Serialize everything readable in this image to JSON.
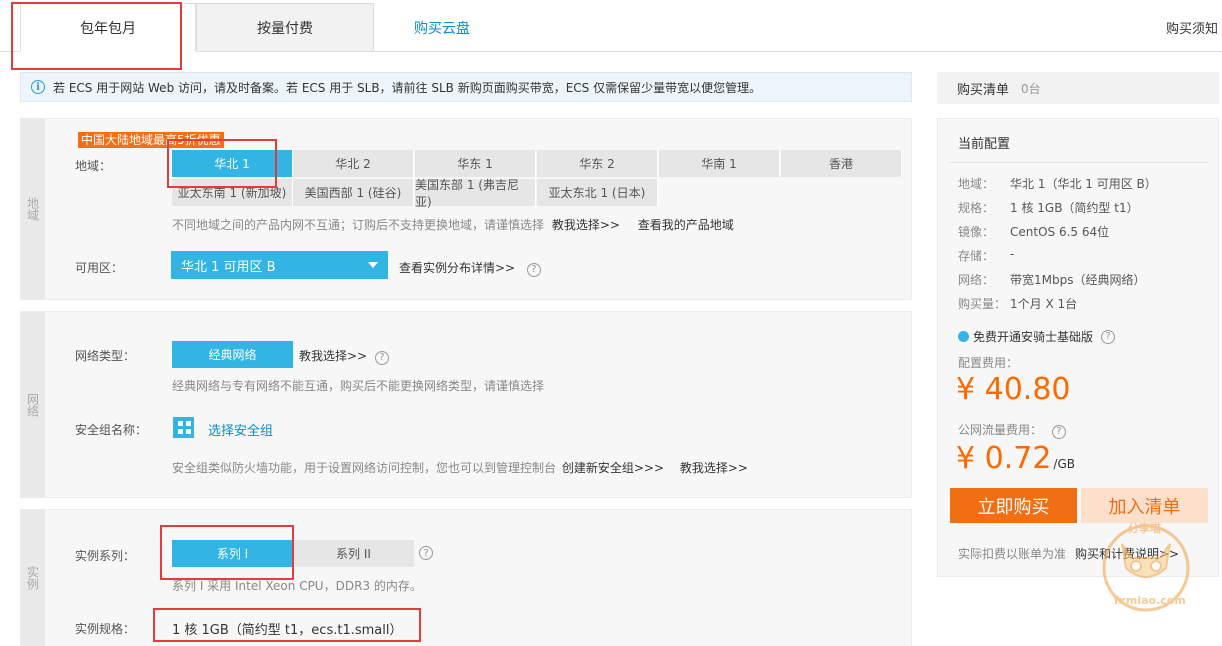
{
  "tabs": {
    "monthly": "包年包月",
    "payg": "按量付费",
    "cloud_disk": "购买云盘",
    "buy_notice": "购买须知"
  },
  "notice": "若 ECS 用于网站 Web 访问，请及时备案。若 ECS 用于 SLB，请前往 SLB 新购页面购买带宽，ECS 仅需保留少量带宽以便您管理。",
  "region_section": {
    "side_label": "地域",
    "promo": "中国大陆地域最高5折优惠",
    "region_label": "地域：",
    "regions_row1": [
      "华北 1",
      "华北 2",
      "华东 1",
      "华东 2",
      "华南 1",
      "香港"
    ],
    "regions_row2": [
      "亚太东南 1 (新加坡)",
      "美国西部 1 (硅谷)",
      "美国东部 1 (弗吉尼亚)",
      "亚太东北 1 (日本)"
    ],
    "hint": "不同地域之间的产品内网不互通；订购后不支持更换地域，请谨慎选择",
    "guide_link": "教我选择>>",
    "my_regions_link": "查看我的产品地域",
    "zone_label": "可用区：",
    "zone_value": "华北 1 可用区 B",
    "zone_details_link": "查看实例分布详情>>",
    "help": "?"
  },
  "network_section": {
    "side_label": "网络",
    "type_label": "网络类型：",
    "type_value": "经典网络",
    "guide_link": "教我选择>>",
    "type_hint": "经典网络与专有网络不能互通，购买后不能更换网络类型，请谨慎选择",
    "sg_label": "安全组名称：",
    "sg_select": "选择安全组",
    "sg_hint": "安全组类似防火墙功能，用于设置网络访问控制，您也可以到管理控制台",
    "sg_create_link": "创建新安全组>>>",
    "sg_guide_link": "教我选择>>",
    "help": "?"
  },
  "instance_section": {
    "side_label": "实例",
    "series_label": "实例系列：",
    "series": [
      "系列 I",
      "系列 II"
    ],
    "series_hint": "系列 I 采用 Intel Xeon CPU，DDR3 的内存。",
    "spec_label": "实例规格：",
    "spec_value": "1 核 1GB（简约型 t1，ecs.t1.small）",
    "help": "?"
  },
  "cart": {
    "title": "购买清单",
    "count": "0台"
  },
  "config": {
    "title": "当前配置",
    "rows": [
      {
        "k": "地域：",
        "v": "华北 1（华北 1 可用区 B）"
      },
      {
        "k": "规格：",
        "v": "1 核 1GB（简约型 t1）"
      },
      {
        "k": "镜像：",
        "v": "CentOS 6.5 64位"
      },
      {
        "k": "存储：",
        "v": "-"
      },
      {
        "k": "网络：",
        "v": "带宽1Mbps（经典网络）"
      },
      {
        "k": "购买量：",
        "v": "1个月 X 1台"
      }
    ],
    "anqi": "免费开通安骑士基础版",
    "fee_label": "配置费用：",
    "fee": "¥ 40.80",
    "traffic_label": "公网流量费用：",
    "traffic_fee": "¥ 0.72",
    "traffic_unit": "/GB",
    "buy_now": "立即购买",
    "add_cart": "加入清单",
    "foot_note": "实际扣费以账单为准",
    "foot_link": "购买和计费说明>>",
    "help": "?"
  },
  "watermark": {
    "title": "分享喵",
    "url": "fxmiao.com"
  }
}
